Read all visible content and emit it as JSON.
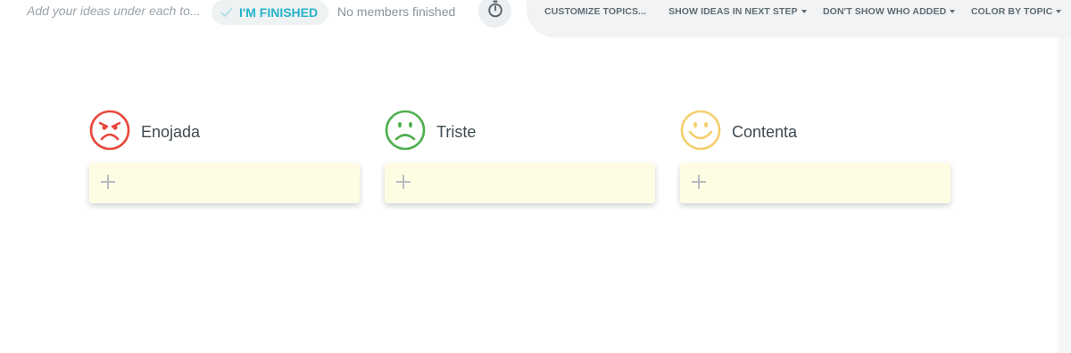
{
  "header": {
    "hint_text": "Add your ideas under each to...",
    "finish_label": "I'M FINISHED",
    "members_status": "No members finished"
  },
  "toolbar": {
    "customize_label": "CUSTOMIZE TOPICS...",
    "show_ideas_label": "SHOW IDEAS IN NEXT STEP",
    "dont_show_label": "DON'T SHOW WHO ADDED",
    "color_by_label": "COLOR BY TOPIC"
  },
  "topics": [
    {
      "title": "Enojada",
      "icon": "angry-face-icon",
      "color": "#e8473a"
    },
    {
      "title": "Triste",
      "icon": "sad-face-icon",
      "color": "#4fae4e"
    },
    {
      "title": "Contenta",
      "icon": "happy-face-icon",
      "color": "#f5cf6e"
    }
  ],
  "colors": {
    "accent": "#24b3c9",
    "card_background": "#fefde4"
  }
}
